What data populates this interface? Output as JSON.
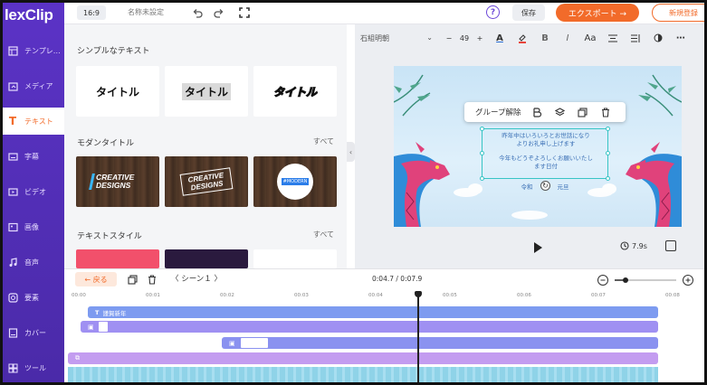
{
  "app": {
    "logo": "lexClip"
  },
  "sidebar": {
    "items": [
      {
        "label": "テンプレ…",
        "icon": "template-icon"
      },
      {
        "label": "メディア",
        "icon": "media-icon"
      },
      {
        "label": "テキスト",
        "icon": "text-icon",
        "active": true
      },
      {
        "label": "字幕",
        "icon": "subtitle-icon"
      },
      {
        "label": "ビデオ",
        "icon": "video-icon"
      },
      {
        "label": "画像",
        "icon": "image-icon"
      },
      {
        "label": "音声",
        "icon": "audio-icon"
      },
      {
        "label": "要素",
        "icon": "element-icon"
      },
      {
        "label": "カバー",
        "icon": "cover-icon"
      },
      {
        "label": "ツール",
        "icon": "tool-icon"
      }
    ]
  },
  "topbar": {
    "ratio": "16:9",
    "project_name": "名称未設定",
    "save": "保存",
    "export": "エクスポート →",
    "new": "新規登録"
  },
  "panel": {
    "simple_title": "シンプルなテキスト",
    "simple_cards": [
      "タイトル",
      "タイトル",
      "タイトル"
    ],
    "modern_title": "モダンタイトル",
    "modern_see_all": "すべて",
    "modern_cards": {
      "card1": "CREATIVE DESIGNS",
      "card2": "CREATIVE DESIGNS",
      "card3": "#MODERN"
    },
    "style_title": "テキストスタイル",
    "style_see_all": "すべて"
  },
  "format_bar": {
    "font": "石組明朝",
    "minus": "−",
    "size": "49",
    "plus": "+",
    "case_label": "Aa"
  },
  "canvas": {
    "context_menu": {
      "ungroup": "グループ解除"
    },
    "text_line1": "昨年中はいろいろとお世話になり",
    "text_line2": "よりお礼申し上げます",
    "text_line3": "今年もどうぞよろしくお願いいたし",
    "text_line4": "ます日付",
    "sub_left": "令和",
    "sub_right": "元旦"
  },
  "player": {
    "duration": "7.9s"
  },
  "timeline": {
    "back": "← 戻る",
    "scene": "〈  シーン１  〉",
    "timecode": "0:04.7 / 0:07.9",
    "ruler": [
      "00:00",
      "00:01",
      "00:02",
      "00:03",
      "00:04",
      "00:05",
      "00:06",
      "00:07",
      "00:08"
    ],
    "text_track_label": "謹賀新年",
    "accent": "#f26b2a",
    "brand": "#5b33c6"
  }
}
